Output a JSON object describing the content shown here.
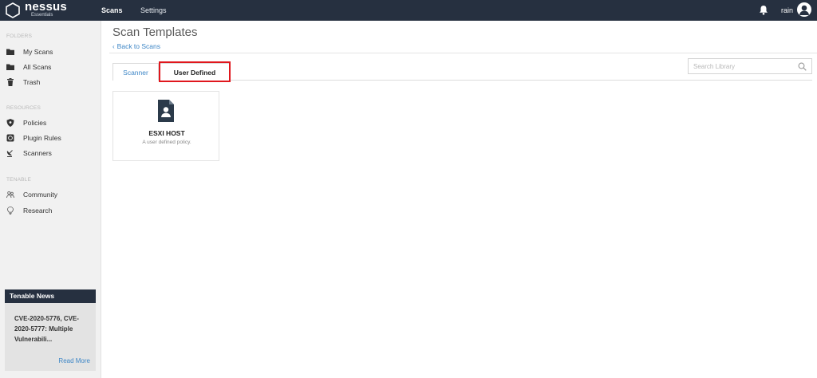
{
  "app": {
    "logo_text": "nessus",
    "logo_sub": "Essentials"
  },
  "topnav": {
    "items": [
      {
        "label": "Scans"
      },
      {
        "label": "Settings"
      }
    ],
    "username": "rain",
    "bell_icon": "bell-icon",
    "user_icon": "user-icon"
  },
  "sidebar": {
    "sections": [
      {
        "heading": "FOLDERS",
        "items": [
          {
            "label": "My Scans",
            "icon": "folder-icon"
          },
          {
            "label": "All Scans",
            "icon": "folder-icon"
          },
          {
            "label": "Trash",
            "icon": "trash-icon"
          }
        ]
      },
      {
        "heading": "RESOURCES",
        "items": [
          {
            "label": "Policies",
            "icon": "shield-icon"
          },
          {
            "label": "Plugin Rules",
            "icon": "plugin-rules-icon"
          },
          {
            "label": "Scanners",
            "icon": "satellite-dish-icon"
          }
        ]
      },
      {
        "heading": "TENABLE",
        "items": [
          {
            "label": "Community",
            "icon": "community-icon"
          },
          {
            "label": "Research",
            "icon": "lightbulb-icon"
          }
        ]
      }
    ],
    "news": {
      "title": "Tenable News",
      "headline": "CVE-2020-5776, CVE-2020-5777: Multiple Vulnerabili...",
      "read_more": "Read More"
    }
  },
  "main": {
    "title": "Scan Templates",
    "back_link": "Back to Scans",
    "tabs": [
      {
        "label": "Scanner",
        "active": false
      },
      {
        "label": "User Defined",
        "active": true
      }
    ],
    "search": {
      "placeholder": "Search Library",
      "value": ""
    },
    "templates": [
      {
        "title": "ESXI HOST",
        "description": "A user defined policy.",
        "icon": "user-policy-document-icon"
      }
    ]
  },
  "colors": {
    "topbar": "#263040",
    "accent_link": "#3d86c6",
    "highlight": "#e0171d",
    "sidebar_bg": "#f1f1f1"
  }
}
